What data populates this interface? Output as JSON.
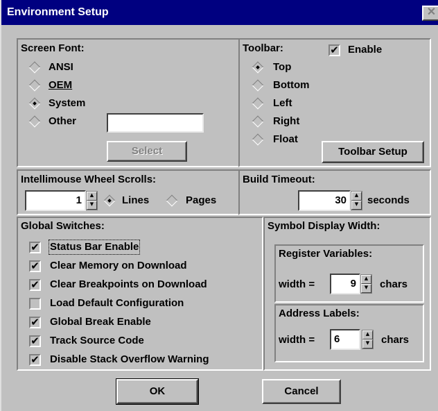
{
  "window": {
    "title": "Environment Setup",
    "close_glyph": "✕"
  },
  "screen_font": {
    "heading": "Screen Font:",
    "options": [
      {
        "label": "ANSI",
        "checked": false
      },
      {
        "label": "OEM",
        "checked": false
      },
      {
        "label": "System",
        "checked": true
      },
      {
        "label": "Other",
        "checked": false
      }
    ],
    "other_value": "",
    "select_label": "Select"
  },
  "toolbar": {
    "heading": "Toolbar:",
    "enable_label": "Enable",
    "enable_checked": true,
    "positions": [
      {
        "label": "Top",
        "checked": true
      },
      {
        "label": "Bottom",
        "checked": false
      },
      {
        "label": "Left",
        "checked": false
      },
      {
        "label": "Right",
        "checked": false
      },
      {
        "label": "Float",
        "checked": false
      }
    ],
    "setup_label": "Toolbar Setup"
  },
  "intellimouse": {
    "heading": "Intellimouse Wheel Scrolls:",
    "value": "1",
    "lines_label": "Lines",
    "lines_checked": true,
    "pages_label": "Pages",
    "pages_checked": false
  },
  "build_timeout": {
    "heading": "Build Timeout:",
    "value": "30",
    "unit": "seconds"
  },
  "global_switches": {
    "heading": "Global Switches:",
    "items": [
      {
        "label": "Status Bar Enable",
        "checked": true
      },
      {
        "label": "Clear Memory on Download",
        "checked": true
      },
      {
        "label": "Clear Breakpoints on Download",
        "checked": true
      },
      {
        "label": "Load Default Configuration",
        "checked": false
      },
      {
        "label": "Global Break Enable",
        "checked": true
      },
      {
        "label": "Track Source Code",
        "checked": true
      },
      {
        "label": "Disable Stack Overflow Warning",
        "checked": true
      }
    ]
  },
  "symbol_display": {
    "heading": "Symbol Display Width:",
    "register": {
      "heading": "Register Variables:",
      "width_label": "width =",
      "value": "9",
      "unit": "chars"
    },
    "address": {
      "heading": "Address Labels:",
      "width_label": "width =",
      "value": "6",
      "unit": "chars"
    }
  },
  "buttons": {
    "ok_label": "OK",
    "cancel_label": "Cancel"
  },
  "glyphs": {
    "check": "✔",
    "spin_up": "▲",
    "spin_down": "▼"
  }
}
